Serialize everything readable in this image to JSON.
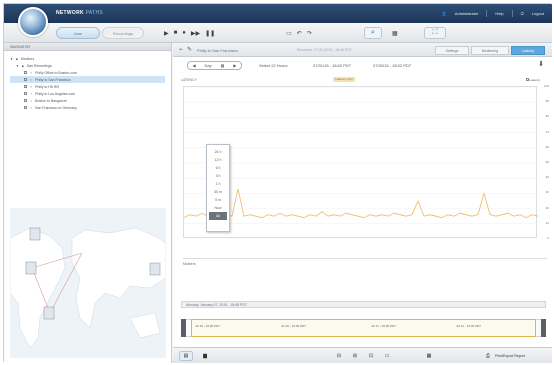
{
  "header": {
    "brand": "NETWORK",
    "brand_accent": "PATHS",
    "user": "Administrator",
    "help": "Help",
    "logout": "Logout"
  },
  "toolbar": {
    "tabs": [
      {
        "label": "Live"
      },
      {
        "label": "Recordings"
      }
    ]
  },
  "left": {
    "panel_title": "NAVIGATOR",
    "tree": [
      {
        "label": "Monitors",
        "level": 0,
        "expanded": true
      },
      {
        "label": "San Recordings",
        "level": 1,
        "expanded": true
      },
      {
        "label": "Philly Office to Boston.com",
        "level": 2
      },
      {
        "label": "Philly to San Francisco",
        "level": 2,
        "selected": true
      },
      {
        "label": "Philly to HK BR",
        "level": 2
      },
      {
        "label": "Philly to Los Angeles.com",
        "level": 2
      },
      {
        "label": "Boston to Bangalore",
        "level": 2
      },
      {
        "label": "San Francisco to Germany",
        "level": 2
      }
    ]
  },
  "main": {
    "title": "Philly to San Francisco",
    "title_time": "Recorded: 07-31-2015 - 18:48 PDT",
    "tabs": [
      "Settings",
      "Monitoring",
      "Latency"
    ],
    "nav_range": "Day",
    "range_text_1": "Select 22 Hours",
    "range_text_2": "07/31/15 - 18:02 PDT",
    "range_text_3": "07/30/15 - 18:02 PDT",
    "plot_label": "LATENCY",
    "plot_badge": "Latency (ms)",
    "plot_legend": "Latency",
    "zoom_options": [
      "24 h",
      "12 h",
      "6 h",
      "3 h",
      "1 h",
      "30 m",
      "5 m",
      "Now",
      "All"
    ],
    "zoom_selected": "All",
    "sub_label": "Markers",
    "timeline_label": "Monday, January 07, 2015 - 18:48 PDT",
    "timeline_marks": [
      "Jul 30 - 18:00 PDT",
      "Jul 30 - 23:00 PDT",
      "Jul 31 - 06:00 PDT",
      "Jul 31 - 12:00 PDT"
    ],
    "bottom_right": "Print/Export Report"
  },
  "colors": {
    "accent": "#5ba7e0",
    "header": "#1b3557",
    "series": "#f0b95a"
  },
  "chart_data": {
    "type": "line",
    "title": "",
    "xlabel": "",
    "ylabel": "",
    "ylim": [
      0,
      100
    ],
    "series": [
      {
        "name": "Latency",
        "values": [
          14,
          16,
          15,
          17,
          15,
          16,
          14,
          16,
          15,
          33,
          15,
          16,
          15,
          14,
          16,
          15,
          17,
          15,
          16,
          15,
          14,
          16,
          15,
          18,
          15,
          16,
          15,
          17,
          16,
          15,
          14,
          16,
          15,
          16,
          15,
          17,
          16,
          15,
          16,
          25,
          15,
          16,
          15,
          14,
          16,
          15,
          17,
          16,
          15,
          16,
          30,
          16,
          15,
          16,
          17,
          15,
          16,
          14,
          16,
          15
        ]
      }
    ]
  }
}
